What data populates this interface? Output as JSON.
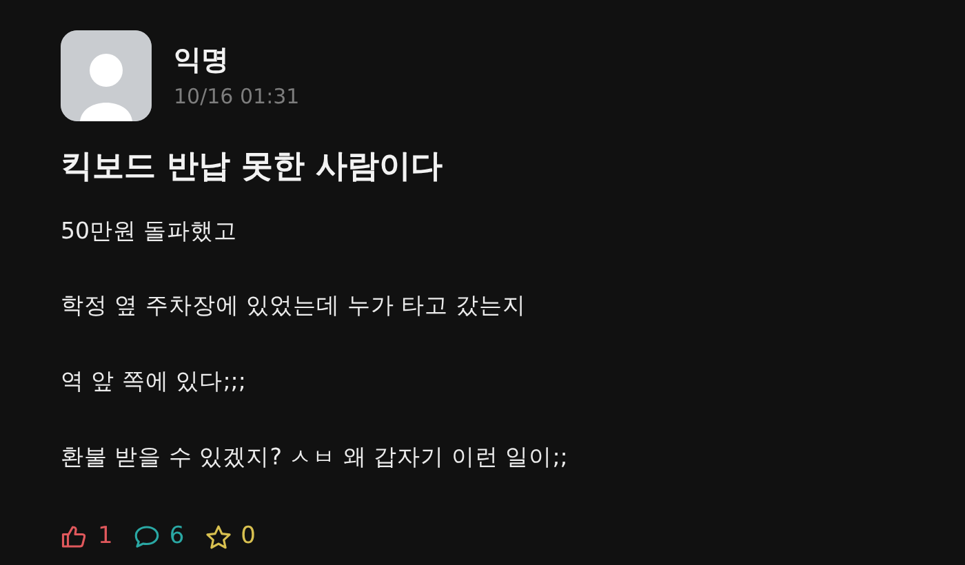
{
  "post": {
    "author": "익명",
    "date": "10/16 01:31",
    "title": "킥보드 반납 못한 사람이다",
    "paragraphs": [
      "50만원 돌파했고",
      "학정 옆 주차장에 있었는데 누가 타고 갔는지",
      "역 앞 쪽에 있다;;;",
      "환불 받을 수 있겠지? ㅅㅂ 왜 갑자기 이런 일이;;"
    ]
  },
  "stats": [
    {
      "kind": "like",
      "count": "1",
      "color": "#e0585c"
    },
    {
      "kind": "comment",
      "count": "6",
      "color": "#2aa8a4"
    },
    {
      "kind": "scrap",
      "count": "0",
      "color": "#d8c050"
    }
  ]
}
